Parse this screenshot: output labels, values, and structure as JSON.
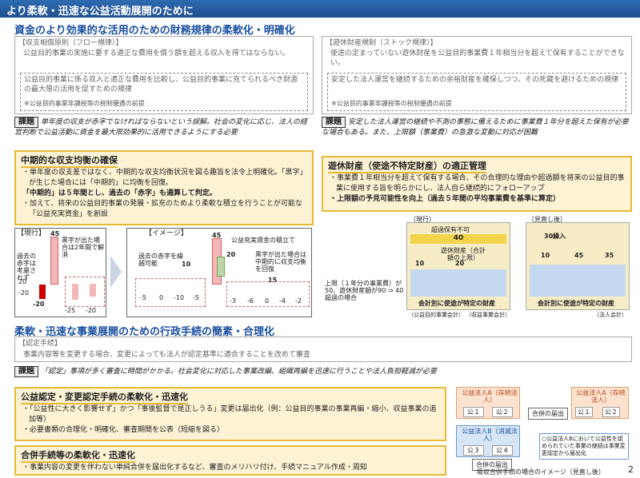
{
  "header": {
    "title": "より柔軟・迅速な公益活動展開のために"
  },
  "section1": {
    "title": "資金のより効果的な活用のための財務規律の柔軟化・明確化",
    "left": {
      "rule_title": "【収支相償原則（フロー規律）】",
      "rule_text": "公益目的事業の実施に要する適正な費用を償う額を超える収入を得てはならない。",
      "inner_text": "公益目的事業に係る収入と適正な費用を比較し、公益目的事業に充てられるべき財源の最大限の活用を促すための規律",
      "inner_note": "※公益目的事業非課税等の税制優遇の前提",
      "kadai_tag": "課題",
      "kadai_text": "単年度の収支が赤字でなければならないという誤解。社会の変化に応じ、法人の経営判断で公益活動に資金を最大限効果的に活用できるようにする必要",
      "hl_title": "中期的な収支均衡の確保",
      "b1": "・単年度の収支差ではなく、中期的な収支均衡状況を図る趣旨を法令上明確化。「黒字」が生じた場合には「中期的」に均衡を回復。",
      "b2": "「中期的」は５年間とし、過去の「赤字」も通算して判定。",
      "b3": "・加えて、将来の公益目的事業の発展・拡充のためより柔軟な積立を行うことが可能な「公益充実資金」を創設"
    },
    "right": {
      "rule_title": "【遊休財産規制（ストック規律）】",
      "rule_text": "使途の定まっていない遊休財産を公益目的事業費１年相当分を超えて保有することができない。",
      "inner_text": "安定した法人運営を継続するための余裕財産を確保しつつ、その死蔵を避けるための規律",
      "inner_note": "※公益目的事業非課税等の税制優遇の前提",
      "kadai_tag": "課題",
      "kadai_text": "安定した法人運営の継続や不測の事態に備えるために事業費１年分を超えた保有が必要な場合もある。また、上限額（事業費）の急激な変動に対応が困難",
      "hl_title": "遊休財産（使途不特定財産）の適正管理",
      "b1": "・事業費１年相当分を超えて保有する場合、その合理的な理由や超過額を将来の公益目的事業に使用する旨を明らかにし、法人自ら継続的にフォローアップ",
      "b2": "・上限額の予見可能性を向上（過去５年間の平均事業費を基準に算定）"
    }
  },
  "chart_current": {
    "label": "【現行】",
    "note1": "過去の赤字は考慮されず",
    "note2": "黒字が出た場合は2年間で解消",
    "v45": "45",
    "v20": "-20",
    "v25": "-25",
    "v20b": "-20",
    "ticks": [
      "20",
      "0",
      "-20",
      "-40"
    ],
    "xlabels": [
      "t-4年",
      "t年",
      "t+1年",
      "t+2年"
    ]
  },
  "chart_image": {
    "label": "【イメージ】",
    "note_top": "公益充実資金の積立て",
    "note_left": "過去の赤字を繰越可能",
    "note_left_val": "10",
    "note_right": "黒字が出た場合は中期的に収支均衡を回復",
    "v45": "45",
    "v20": "20",
    "v15": "15",
    "vals": [
      "-5",
      "0",
      "-10",
      "-5",
      "-3",
      "-6",
      "0",
      "-4",
      "-2"
    ],
    "ticks": [
      "20",
      "0",
      "-20"
    ],
    "xlabels": [
      "t-4",
      "t-3",
      "t-2",
      "t-1",
      "t年",
      "t+1",
      "t+2",
      "t+3",
      "t+4"
    ]
  },
  "chart_stock": {
    "label_current": "（現行）",
    "label_new": "（見直し後）",
    "excess": "超過保有不可",
    "v40": "40",
    "fund_label": "遊休財産（合計額の上限）",
    "v20": "20",
    "v10": "10",
    "v45": "45",
    "v35": "35",
    "carry": "30繰入",
    "bottom": "会計別に使途が特定の財産",
    "footer1": "（公益目的事業会計）",
    "footer2": "（収益事業会計）",
    "footer3": "（法人会計）",
    "side_note": "上限（１年分の事業費）が50、遊休財産額が90 ⇒ 40超過の場合"
  },
  "section2": {
    "title": "柔軟・迅速な事業展開のための行政手続の簡素・合理化",
    "rule_title": "【認定手続】",
    "rule_text": "事業内容等を変更する場合、変更によっても法人が認定基準に適合することを改めて審査",
    "kadai_tag": "課題",
    "kadai_text": "「認定」事項が多く審査に時間がかかる。社会変化に対応した事業改編、組織再編を迅速に行うことや法人負担軽減が必要",
    "hl1_title": "公益認定・変更認定手続の柔軟化・迅速化",
    "hl1_b1": "・「公益性に大きく影響せず」かつ「事後監督で是正しうる」変更は届出化（例：公益目的事業の事業再編・縮小、収益事業の追加等）",
    "hl1_b2": "・必要書類の合理化・明確化、審査期間を公表（短縮を図る）",
    "hl2_title": "合併手続等の柔軟化・迅速化",
    "hl2_b1": "・事業内容の変更を伴わない単純合併を届出化するなど、審査のメリハリ付け、手続マニュアル作成・周知"
  },
  "merger": {
    "corpA": "公益法人A（存続法人）",
    "corpB": "公益法人B（消滅法人）",
    "corpA2": "公益法人A（存続法人）",
    "k1": "公１",
    "k2": "公２",
    "k3": "公３",
    "k4": "公４",
    "notice": "合併の届出",
    "notice2": "合併の届出",
    "callout": "○公益法人Bにおいて公益性を認められていた事業の継続は事業変更認定から届出化",
    "caption": "吸収合併手続の場合のイメージ（見直し後）"
  },
  "page": {
    "number": "2"
  }
}
